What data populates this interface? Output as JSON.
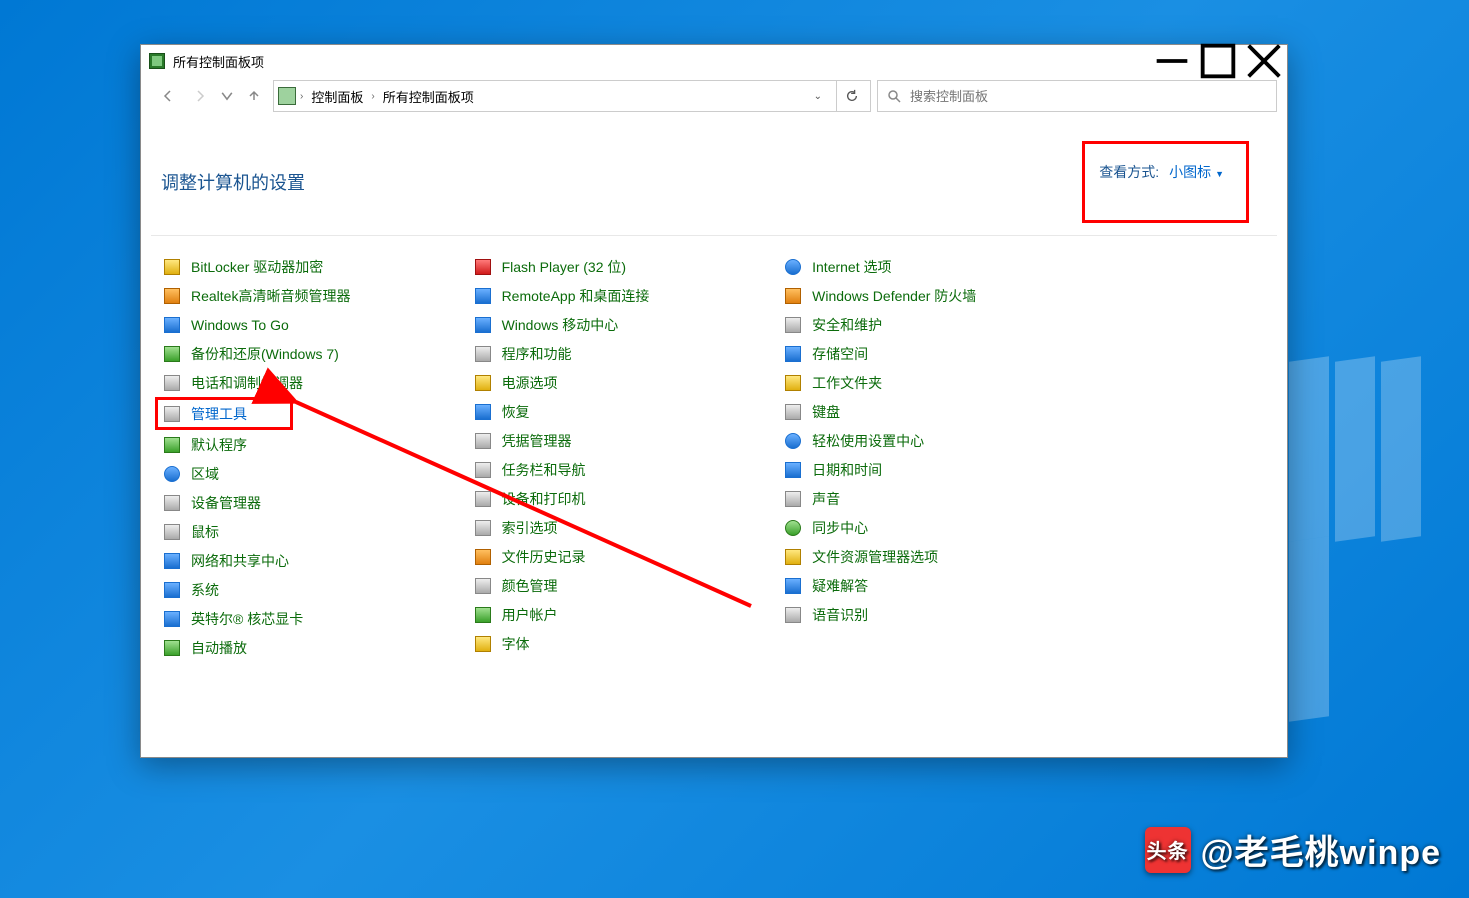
{
  "window": {
    "title": "所有控制面板项"
  },
  "nav": {
    "crumb1": "控制面板",
    "crumb2": "所有控制面板项"
  },
  "search": {
    "placeholder": "搜索控制面板"
  },
  "header": {
    "title": "调整计算机的设置",
    "view_label": "查看方式:",
    "view_value": "小图标"
  },
  "col1": [
    "BitLocker 驱动器加密",
    "Realtek高清晰音频管理器",
    "Windows To Go",
    "备份和还原(Windows 7)",
    "电话和调制解调器",
    "管理工具",
    "默认程序",
    "区域",
    "设备管理器",
    "鼠标",
    "网络和共享中心",
    "系统",
    "英特尔® 核芯显卡",
    "自动播放"
  ],
  "col2": [
    "Flash Player (32 位)",
    "RemoteApp 和桌面连接",
    "Windows 移动中心",
    "程序和功能",
    "电源选项",
    "恢复",
    "凭据管理器",
    "任务栏和导航",
    "设备和打印机",
    "索引选项",
    "文件历史记录",
    "颜色管理",
    "用户帐户",
    "字体"
  ],
  "col3": [
    "Internet 选项",
    "Windows Defender 防火墙",
    "安全和维护",
    "存储空间",
    "工作文件夹",
    "键盘",
    "轻松使用设置中心",
    "日期和时间",
    "声音",
    "同步中心",
    "文件资源管理器选项",
    "疑难解答",
    "语音识别"
  ],
  "icon_classes": {
    "col1": [
      "ic-square ic-yellow",
      "ic-square ic-orange",
      "ic-square ic-blue",
      "ic-square ic-green",
      "ic-square ic-grey",
      "ic-square ic-grey",
      "ic-square ic-green",
      "ic-square ic-blue ic-circle",
      "ic-square ic-grey",
      "ic-square ic-grey",
      "ic-square ic-blue",
      "ic-square ic-blue",
      "ic-square ic-blue",
      "ic-square ic-green"
    ],
    "col2": [
      "ic-square ic-red",
      "ic-square ic-blue",
      "ic-square ic-blue",
      "ic-square ic-grey",
      "ic-square ic-yellow",
      "ic-square ic-blue",
      "ic-square ic-grey",
      "ic-square ic-grey",
      "ic-square ic-grey",
      "ic-square ic-grey",
      "ic-square ic-orange",
      "ic-square ic-grey",
      "ic-square ic-green",
      "ic-square ic-yellow"
    ],
    "col3": [
      "ic-square ic-blue ic-circle",
      "ic-square ic-orange",
      "ic-square ic-grey",
      "ic-square ic-blue",
      "ic-square ic-yellow",
      "ic-square ic-grey",
      "ic-square ic-blue ic-circle",
      "ic-square ic-blue",
      "ic-square ic-grey",
      "ic-square ic-green ic-circle",
      "ic-square ic-yellow",
      "ic-square ic-blue",
      "ic-square ic-grey"
    ]
  },
  "watermark": {
    "logo": "头条",
    "text": "@老毛桃winpe"
  }
}
